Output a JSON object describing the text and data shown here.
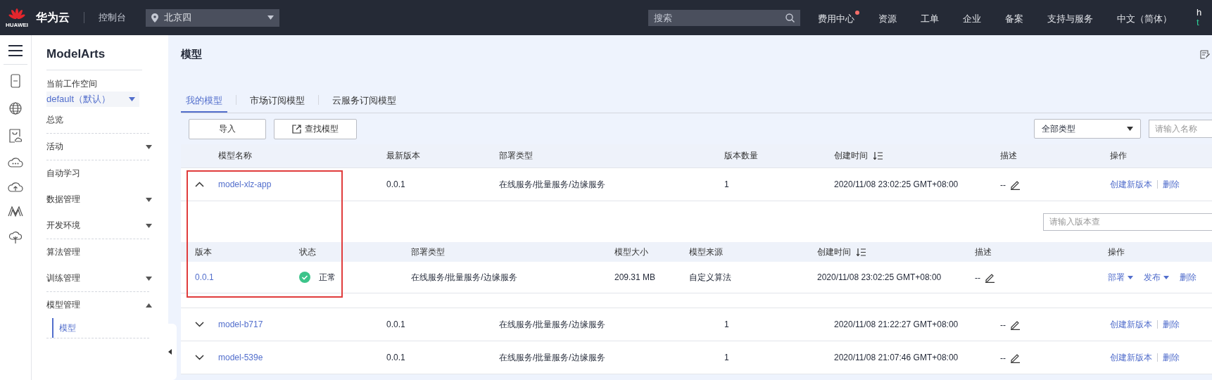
{
  "topbar": {
    "logo_caption": "HUAWEI",
    "brand": "华为云",
    "console": "控制台",
    "region": "北京四",
    "search": {
      "placeholder": "搜索"
    },
    "nav": [
      {
        "label": "费用中心",
        "notification": true
      },
      {
        "label": "资源",
        "notification": false
      },
      {
        "label": "工单",
        "notification": false
      },
      {
        "label": "企业",
        "notification": false
      },
      {
        "label": "备案",
        "notification": false
      },
      {
        "label": "支持与服务",
        "notification": false
      },
      {
        "label": "中文（简体）",
        "notification": false
      }
    ],
    "account_lines": [
      "h",
      "t"
    ]
  },
  "sidebar": {
    "title": "ModelArts",
    "workspace_label": "当前工作空间",
    "workspace": "default（默认）",
    "sections": [
      [
        {
          "label": "总览",
          "kind": "link"
        }
      ],
      [
        {
          "label": "活动",
          "kind": "group",
          "expanded": false
        }
      ],
      [
        {
          "label": "自动学习",
          "kind": "link"
        },
        {
          "label": "数据管理",
          "kind": "group",
          "expanded": false
        },
        {
          "label": "开发环境",
          "kind": "group",
          "expanded": false
        }
      ],
      [
        {
          "label": "算法管理",
          "kind": "link"
        },
        {
          "label": "训练管理",
          "kind": "group",
          "expanded": false
        }
      ],
      [
        {
          "label": "模型管理",
          "kind": "group",
          "expanded": true,
          "children": [
            {
              "label": "模型",
              "selected": true
            }
          ]
        }
      ]
    ]
  },
  "page_title": "模型",
  "tabs": [
    {
      "label": "我的模型",
      "selected": true
    },
    {
      "label": "市场订阅模型",
      "selected": false
    },
    {
      "label": "云服务订阅模型",
      "selected": false
    }
  ],
  "toolbar": {
    "buttons": [
      {
        "label": "导入",
        "kind": "plain"
      },
      {
        "label": "查找模型",
        "kind": "external"
      }
    ],
    "type_filter": "全部类型",
    "search": {
      "placeholder": "请输入名称"
    }
  },
  "table": {
    "columns": [
      {
        "label": "模型名称",
        "sortable": false
      },
      {
        "label": "最新版本",
        "sortable": false
      },
      {
        "label": "部署类型",
        "sortable": false
      },
      {
        "label": "版本数量",
        "sortable": false
      },
      {
        "label": "创建时间",
        "sortable": true
      },
      {
        "label": "描述",
        "sortable": false
      },
      {
        "label": "操作",
        "sortable": false
      }
    ],
    "rows": [
      {
        "expanded": true,
        "highlighted": true,
        "name": "model-xlz-app",
        "version": "0.0.1",
        "deploy_type": "在线服务/批量服务/边缘服务",
        "version_count": "1",
        "created": "2020/11/08 23:02:25 GMT+08:00",
        "description": "--",
        "actions": [
          "创建新版本",
          "删除"
        ],
        "versions": {
          "search": {
            "placeholder": "请输入版本查"
          },
          "columns": [
            {
              "label": "版本",
              "sortable": false
            },
            {
              "label": "状态",
              "sortable": false
            },
            {
              "label": "部署类型",
              "sortable": false
            },
            {
              "label": "模型大小",
              "sortable": false
            },
            {
              "label": "模型来源",
              "sortable": false
            },
            {
              "label": "创建时间",
              "sortable": true
            },
            {
              "label": "描述",
              "sortable": false
            },
            {
              "label": "操作",
              "sortable": false
            }
          ],
          "rows": [
            {
              "version": "0.0.1",
              "status": {
                "kind": "normal",
                "label": "正常"
              },
              "deploy_type": "在线服务/批量服务/边缘服务",
              "size": "209.31 MB",
              "source": "自定义算法",
              "created": "2020/11/08 23:02:25 GMT+08:00",
              "description": "--",
              "actions": [
                {
                  "label": "部署",
                  "dropdown": true
                },
                {
                  "label": "发布",
                  "dropdown": true
                },
                {
                  "label": "删除",
                  "dropdown": false
                }
              ]
            }
          ]
        }
      },
      {
        "expanded": false,
        "highlighted": false,
        "name": "model-b717",
        "version": "0.0.1",
        "deploy_type": "在线服务/批量服务/边缘服务",
        "version_count": "1",
        "created": "2020/11/08 21:22:27 GMT+08:00",
        "description": "--",
        "actions": [
          "创建新版本",
          "删除"
        ]
      },
      {
        "expanded": false,
        "highlighted": false,
        "name": "model-539e",
        "version": "0.0.1",
        "deploy_type": "在线服务/批量服务/边缘服务",
        "version_count": "1",
        "created": "2020/11/08 21:07:46 GMT+08:00",
        "description": "--",
        "actions": [
          "创建新版本",
          "删除"
        ]
      }
    ]
  }
}
